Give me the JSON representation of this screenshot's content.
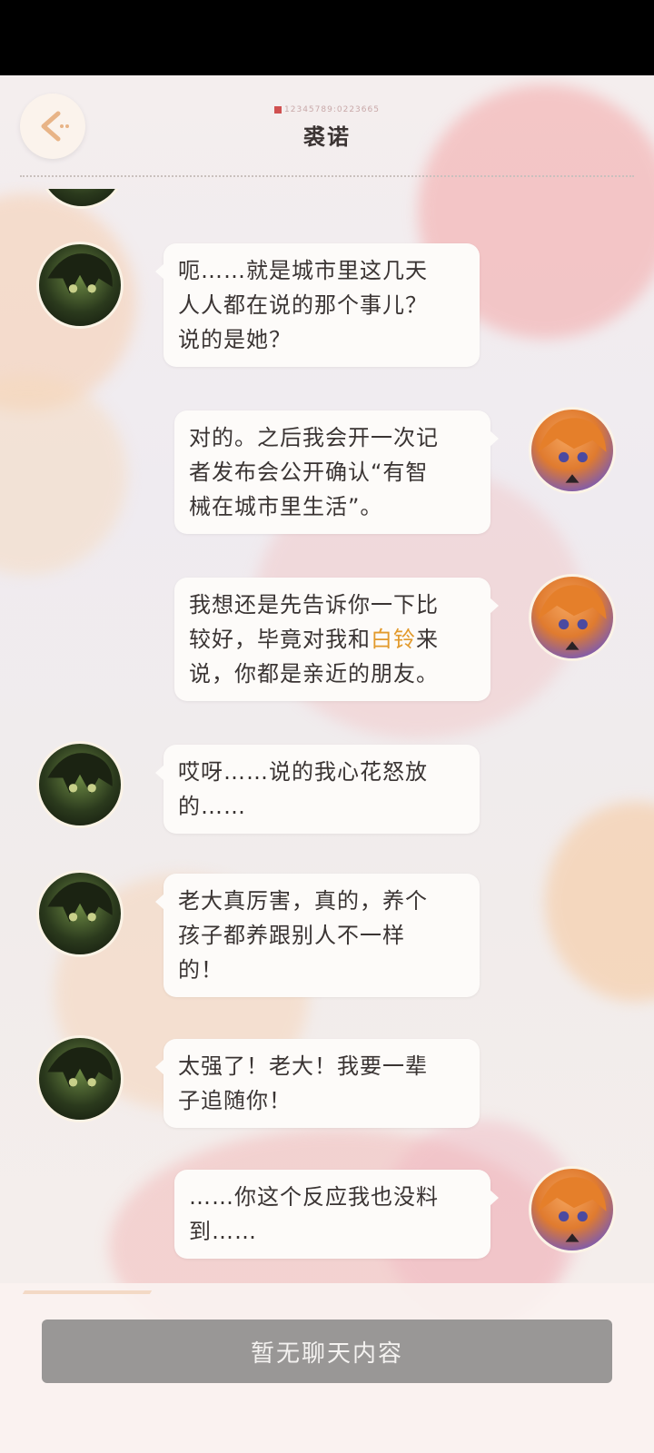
{
  "header": {
    "title": "裘诺",
    "uid": "12345789:0223665"
  },
  "messages": [
    {
      "side": "left",
      "avatar": "green-haired-character",
      "lines": [
        "呃……就是城市里这几天",
        "人人都在说的那个事儿？",
        "说的是她？"
      ]
    },
    {
      "side": "right",
      "avatar": "orange-haired-character",
      "lines": [
        "对的。之后我会开一次记",
        "者发布会公开确认“有智",
        "械在城市里生活”。"
      ]
    },
    {
      "side": "right",
      "avatar": "orange-haired-character",
      "lines": [
        "我想还是先告诉你一下比",
        "较好，毕竟对我和",
        "说，你都是亲近的朋友。"
      ],
      "highlight": "白铃",
      "after_highlight": "来"
    },
    {
      "side": "left",
      "avatar": "green-haired-character",
      "lines": [
        "哎呀……说的我心花怒放",
        "的……"
      ]
    },
    {
      "side": "left",
      "avatar": "green-haired-character",
      "lines": [
        "老大真厉害，真的，养个",
        "孩子都养跟别人不一样",
        "的！"
      ]
    },
    {
      "side": "left",
      "avatar": "green-haired-character",
      "lines": [
        "太强了！老大！我要一辈",
        "子追随你！"
      ]
    },
    {
      "side": "right",
      "avatar": "orange-haired-character",
      "lines": [
        "……你这个反应我也没料",
        "到……"
      ]
    }
  ],
  "footer": {
    "input_placeholder": "暂无聊天内容"
  },
  "colors": {
    "highlight": "#e29a2c",
    "button": "#999796",
    "accent": "#e8b487"
  }
}
